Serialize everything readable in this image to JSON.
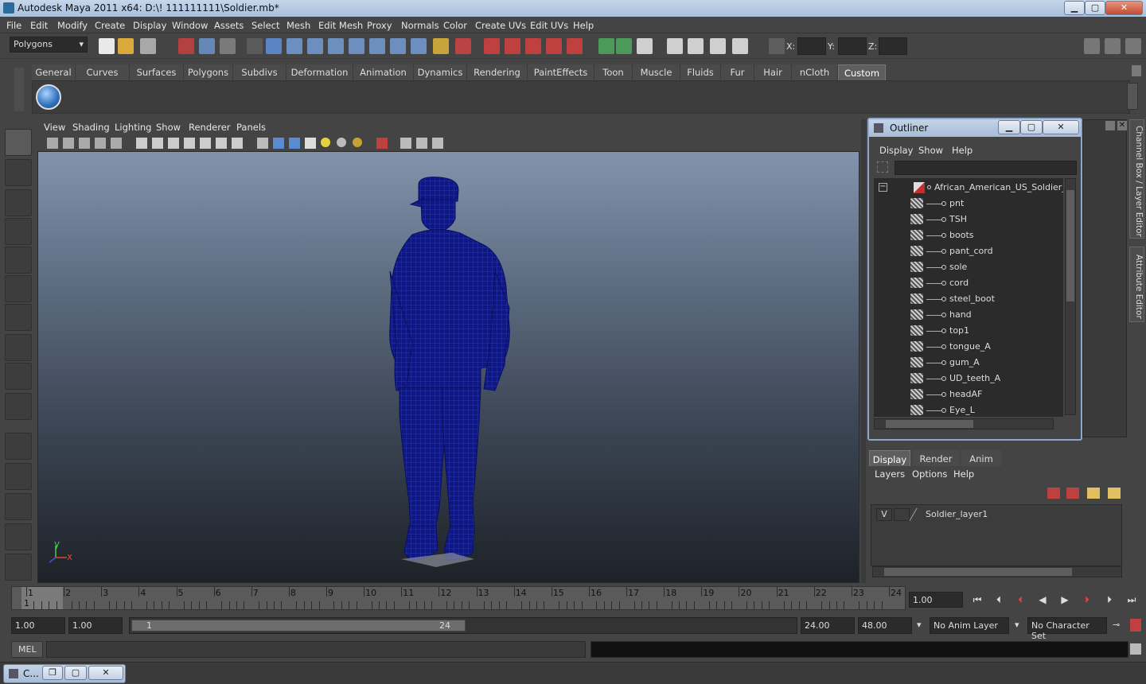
{
  "window": {
    "title": "Autodesk Maya 2011 x64: D:\\! 111111111\\Soldier.mb*"
  },
  "menubar": [
    "File",
    "Edit",
    "Modify",
    "Create",
    "Display",
    "Window",
    "Assets",
    "Select",
    "Mesh",
    "Edit Mesh",
    "Proxy",
    "Normals",
    "Color",
    "Create UVs",
    "Edit UVs",
    "Help"
  ],
  "status": {
    "mode": "Polygons",
    "x_label": "X:",
    "y_label": "Y:",
    "z_label": "Z:"
  },
  "shelf_tabs": [
    "General",
    "Curves",
    "Surfaces",
    "Polygons",
    "Subdivs",
    "Deformation",
    "Animation",
    "Dynamics",
    "Rendering",
    "PaintEffects",
    "Toon",
    "Muscle",
    "Fluids",
    "Fur",
    "Hair",
    "nCloth",
    "Custom"
  ],
  "active_shelf": "Custom",
  "viewport": {
    "menu": [
      "View",
      "Shading",
      "Lighting",
      "Show",
      "Renderer",
      "Panels"
    ],
    "mesh_color": "#101a8f",
    "axis": {
      "y": "y",
      "x": "x"
    }
  },
  "outliner": {
    "title": "Outliner",
    "menu": [
      "Display",
      "Show",
      "Help"
    ],
    "root": "African_American_US_Soldier_Star",
    "items": [
      "pnt",
      "TSH",
      "boots",
      "pant_cord",
      "sole",
      "cord",
      "steel_boot",
      "hand",
      "top1",
      "tongue_A",
      "gum_A",
      "UD_teeth_A",
      "headAF",
      "Eye_L"
    ]
  },
  "side_tabs": {
    "channel": "Channel Box / Layer Editor",
    "attribute": "Attribute Editor"
  },
  "layer_editor": {
    "tabs": [
      "Display",
      "Render",
      "Anim"
    ],
    "menu": [
      "Layers",
      "Options",
      "Help"
    ],
    "layer": {
      "visible": "V",
      "name": "Soldier_layer1"
    }
  },
  "timeline": {
    "ticks": [
      "1",
      "2",
      "3",
      "4",
      "5",
      "6",
      "7",
      "8",
      "9",
      "10",
      "11",
      "12",
      "13",
      "14",
      "15",
      "16",
      "17",
      "18",
      "19",
      "20",
      "21",
      "22",
      "23",
      "24"
    ],
    "current_frame": "1.00",
    "current_marker": "1"
  },
  "range": {
    "start": "1.00",
    "start2": "1.00",
    "range_start": "1",
    "range_end": "24",
    "end": "24.00",
    "end2": "48.00",
    "anim_layer": "No Anim Layer",
    "char_set": "No Character Set"
  },
  "command": {
    "label": "MEL"
  },
  "taskbar": {
    "label": "C..."
  }
}
